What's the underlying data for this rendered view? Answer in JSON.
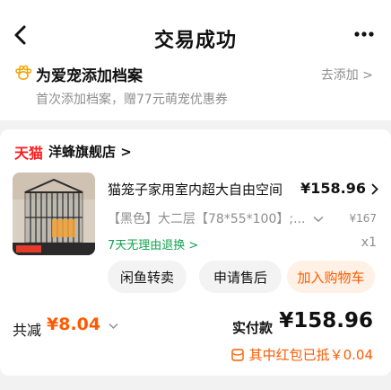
{
  "header": {
    "title": "交易成功",
    "back_icon": "chevron-left-icon",
    "more_icon": "more-dots-icon"
  },
  "pet_banner": {
    "icon": "paw-icon",
    "title": "为爱宠添加档案",
    "subtitle": "首次添加档案，赠77元萌宠优惠券",
    "action": "去添加 >"
  },
  "store": {
    "brand": "天猫",
    "name": "洋蜂旗舰店 >"
  },
  "product": {
    "title": "猫笼子家用室内超大自由空间",
    "price": "¥158.96",
    "sku": "【黑色】大二层【78*55*100】;...",
    "original_price": "¥167",
    "return_policy": "7天无理由退换 >",
    "quantity": "x1"
  },
  "actions": {
    "resell": "闲鱼转卖",
    "after_sale": "申请售后",
    "add_cart": "加入购物车"
  },
  "summary": {
    "saved_label": "共减",
    "saved_value": "¥8.04",
    "paid_label": "实付款",
    "paid_value": "¥158.96",
    "coupon_text": "其中红包已抵￥0.04"
  },
  "colors": {
    "accent": "#ff5a00",
    "tmall_red": "#ff1b1b",
    "green": "#11a34e",
    "muted": "#8e8e8e"
  }
}
